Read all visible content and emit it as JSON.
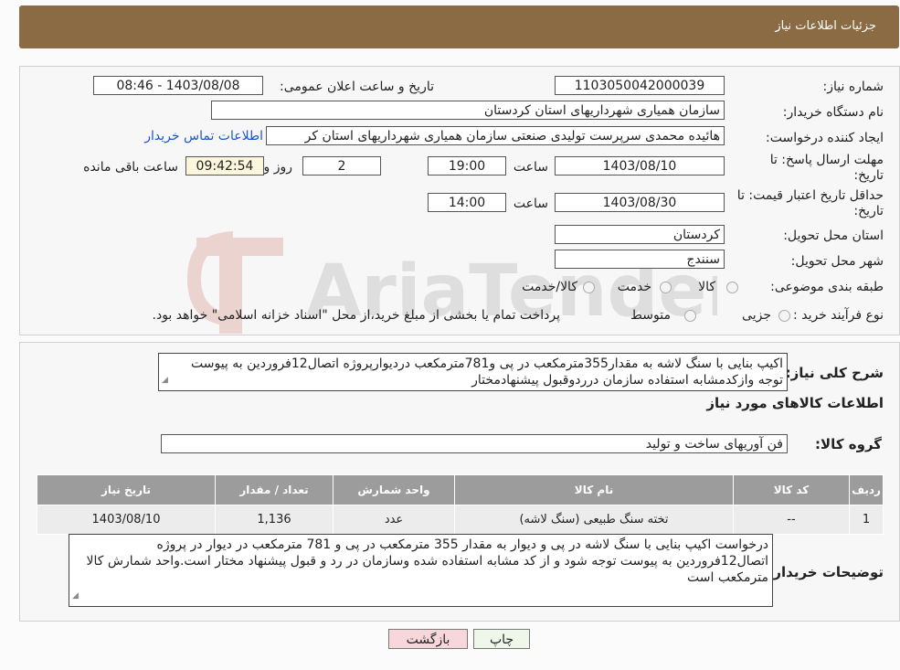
{
  "header": {
    "title": "جزئیات اطلاعات نیاز"
  },
  "form": {
    "need_number_label": "شماره نیاز:",
    "need_number": "1103050042000039",
    "announce_label": "تاریخ و ساعت اعلان عمومی:",
    "announce_value": "1403/08/08 - 08:46",
    "buyer_org_label": "نام دستگاه خریدار:",
    "buyer_org": "سازمان همیاری شهرداریهای استان کردستان",
    "creator_label": "ایجاد کننده درخواست:",
    "creator": "هائیده محمدی سرپرست تولیدی صنعتی سازمان همیاری شهرداریهای استان کر",
    "contact_link": "اطلاعات تماس خریدار",
    "deadline_label_1": "مهلت ارسال پاسخ: تا",
    "deadline_label_2": "تاریخ:",
    "deadline_date": "1403/08/10",
    "time_label": "ساعت",
    "deadline_time": "19:00",
    "days_value": "2",
    "days_label": "روز و",
    "remaining_value": "09:42:54",
    "remaining_label": "ساعت باقی مانده",
    "validity_label_1": "حداقل تاریخ اعتبار قیمت: تا",
    "validity_label_2": "تاریخ:",
    "validity_date": "1403/08/30",
    "validity_time": "14:00",
    "province_label": "استان محل تحویل:",
    "province": "کردستان",
    "city_label": "شهر محل تحویل:",
    "city": "سنندج",
    "category_label": "طبقه بندی موضوعی:",
    "category_options": [
      "کالا",
      "خدمت",
      "کالا/خدمت"
    ],
    "process_label": "نوع فرآیند خرید :",
    "process_options": [
      "جزیی",
      "متوسط"
    ],
    "process_note": "پرداخت تمام یا بخشی از مبلغ خرید،از محل \"اسناد خزانه اسلامی\" خواهد بود."
  },
  "summary": {
    "label": "شرح کلی نیاز:",
    "text": "اکیپ بنایی با سنگ لاشه به مقدار355مترمکعب در پی و781مترمکعب دردیوارپروژه اتصال12فروردین به پیوست توجه وازکدمشابه استفاده سازمان درردوقبول پیشنهادمختار",
    "goods_section_title": "اطلاعات کالاهای مورد نیاز",
    "goods_group_label": "گروه کالا:",
    "goods_group": "فن آوریهای ساخت و تولید"
  },
  "table": {
    "headers": [
      "ردیف",
      "کد کالا",
      "نام کالا",
      "واحد شمارش",
      "تعداد / مقدار",
      "تاریخ نیاز"
    ],
    "rows": [
      [
        "1",
        "--",
        "تخته سنگ طبیعی (سنگ لاشه)",
        "عدد",
        "1,136",
        "1403/08/10"
      ]
    ]
  },
  "buyer_notes": {
    "label": "توضیحات خریدار:",
    "text": "درخواست اکیپ بنایی با سنگ لاشه در پی و دیوار به مقدار 355 مترمکعب در پی و 781 مترمکعب در دیوار در پروژه اتصال12فروردین به پیوست توجه شود و از کد مشابه استفاده شده وسازمان در رد و قبول پیشنهاد مختار است.واحد شمارش کالا مترمکعب است"
  },
  "buttons": {
    "print": "چاپ",
    "back": "بازگشت"
  },
  "watermark": {
    "text": "AriaTender.neT"
  },
  "colors": {
    "header": "#8b6b44",
    "table_header": "#9c9c9c",
    "link": "#1a56c9",
    "back_button": "#f8d7dc"
  }
}
